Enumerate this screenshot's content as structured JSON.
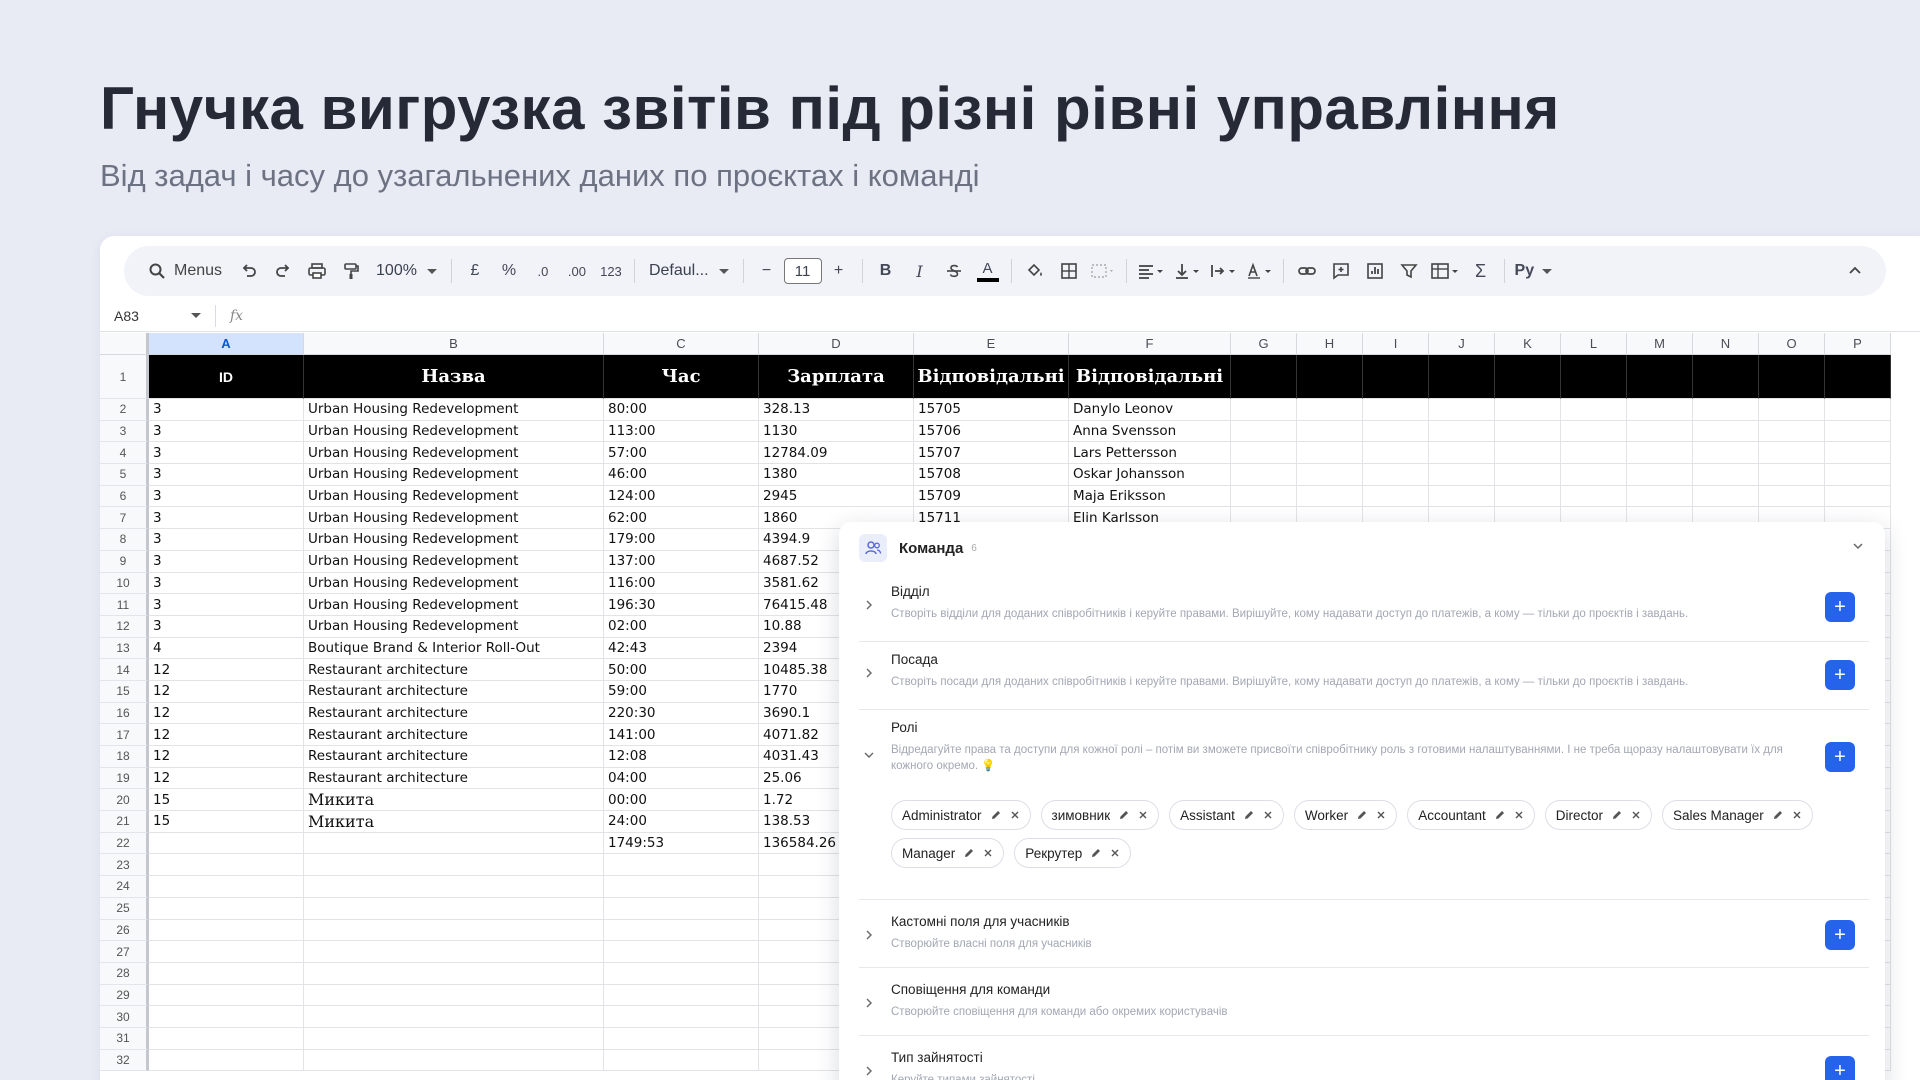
{
  "slide": {
    "title": "Гнучка вигрузка звітів під різні рівні управління",
    "subtitle": "Від задач і часу до узагальнених даних по проєктах і команді"
  },
  "toolbar": {
    "menus_label": "Menus",
    "zoom": "100%",
    "currency": "£",
    "percent": "%",
    "dec_less": ".0",
    "dec_more": ".00",
    "number_format": "123",
    "font": "Defaul...",
    "font_size": "11",
    "bold": "B",
    "italic": "I",
    "text_color_label": "A",
    "sigma": "Σ",
    "ru_label": "Pу"
  },
  "formula_bar": {
    "cell_ref": "A83",
    "fx": "fx"
  },
  "sheet": {
    "columns": [
      "A",
      "B",
      "C",
      "D",
      "E",
      "F",
      "G",
      "H",
      "I",
      "J",
      "K",
      "L",
      "M",
      "N",
      "O",
      "P"
    ],
    "selected_column": "A",
    "header": [
      "ID",
      "Назва",
      "Час",
      "Зарплата",
      "Відповідальні",
      "Відповідальні"
    ],
    "rows": [
      {
        "n": "2",
        "cells": [
          "3",
          "Urban Housing Redevelopment",
          "80:00",
          "328.13",
          "15705",
          "Danylo Leonov"
        ]
      },
      {
        "n": "3",
        "cells": [
          "3",
          "Urban Housing Redevelopment",
          "113:00",
          "1130",
          "15706",
          "Anna Svensson"
        ]
      },
      {
        "n": "4",
        "cells": [
          "3",
          "Urban Housing Redevelopment",
          "57:00",
          "12784.09",
          "15707",
          "Lars Pettersson"
        ]
      },
      {
        "n": "5",
        "cells": [
          "3",
          "Urban Housing Redevelopment",
          "46:00",
          "1380",
          "15708",
          "Oskar Johansson"
        ]
      },
      {
        "n": "6",
        "cells": [
          "3",
          "Urban Housing Redevelopment",
          "124:00",
          "2945",
          "15709",
          "Maja Eriksson"
        ]
      },
      {
        "n": "7",
        "cells": [
          "3",
          "Urban Housing Redevelopment",
          "62:00",
          "1860",
          "15711",
          "Elin Karlsson"
        ]
      },
      {
        "n": "8",
        "cells": [
          "3",
          "Urban Housing Redevelopment",
          "179:00",
          "4394.9",
          "",
          ""
        ]
      },
      {
        "n": "9",
        "cells": [
          "3",
          "Urban Housing Redevelopment",
          "137:00",
          "4687.52",
          "",
          ""
        ]
      },
      {
        "n": "10",
        "cells": [
          "3",
          "Urban Housing Redevelopment",
          "116:00",
          "3581.62",
          "",
          ""
        ]
      },
      {
        "n": "11",
        "cells": [
          "3",
          "Urban Housing Redevelopment",
          "196:30",
          "76415.48",
          "",
          ""
        ]
      },
      {
        "n": "12",
        "cells": [
          "3",
          "Urban Housing Redevelopment",
          "02:00",
          "10.88",
          "",
          ""
        ]
      },
      {
        "n": "13",
        "cells": [
          "4",
          "Boutique Brand & Interior Roll-Out",
          "42:43",
          "2394",
          "",
          ""
        ]
      },
      {
        "n": "14",
        "cells": [
          "12",
          "Restaurant architecture",
          "50:00",
          "10485.38",
          "",
          ""
        ]
      },
      {
        "n": "15",
        "cells": [
          "12",
          "Restaurant architecture",
          "59:00",
          "1770",
          "",
          ""
        ]
      },
      {
        "n": "16",
        "cells": [
          "12",
          "Restaurant architecture",
          "220:30",
          "3690.1",
          "",
          ""
        ]
      },
      {
        "n": "17",
        "cells": [
          "12",
          "Restaurant architecture",
          "141:00",
          "4071.82",
          "",
          ""
        ]
      },
      {
        "n": "18",
        "cells": [
          "12",
          "Restaurant architecture",
          "12:08",
          "4031.43",
          "",
          ""
        ]
      },
      {
        "n": "19",
        "cells": [
          "12",
          "Restaurant architecture",
          "04:00",
          "25.06",
          "",
          ""
        ]
      },
      {
        "n": "20",
        "cells": [
          "15",
          "Микита",
          "00:00",
          "1.72",
          "",
          ""
        ]
      },
      {
        "n": "21",
        "cells": [
          "15",
          "Микита",
          "24:00",
          "138.53",
          "",
          ""
        ]
      },
      {
        "n": "22",
        "cells": [
          "",
          "",
          "1749:53",
          "136584.26",
          "",
          ""
        ]
      },
      {
        "n": "23",
        "cells": [
          "",
          "",
          "",
          "",
          "",
          ""
        ]
      },
      {
        "n": "24",
        "cells": [
          "",
          "",
          "",
          "",
          "",
          ""
        ]
      },
      {
        "n": "25",
        "cells": [
          "",
          "",
          "",
          "",
          "",
          ""
        ]
      },
      {
        "n": "26",
        "cells": [
          "",
          "",
          "",
          "",
          "",
          ""
        ]
      },
      {
        "n": "27",
        "cells": [
          "",
          "",
          "",
          "",
          "",
          ""
        ]
      },
      {
        "n": "28",
        "cells": [
          "",
          "",
          "",
          "",
          "",
          ""
        ]
      },
      {
        "n": "29",
        "cells": [
          "",
          "",
          "",
          "",
          "",
          ""
        ]
      },
      {
        "n": "30",
        "cells": [
          "",
          "",
          "",
          "",
          "",
          ""
        ]
      },
      {
        "n": "31",
        "cells": [
          "",
          "",
          "",
          "",
          "",
          ""
        ]
      },
      {
        "n": "32",
        "cells": [
          "",
          "",
          "",
          "",
          "",
          ""
        ]
      }
    ]
  },
  "team_panel": {
    "title": "Команда",
    "count": "6",
    "sections": {
      "department": {
        "title": "Відділ",
        "desc": "Створіть відділи для доданих співробітників і керуйте правами. Вирішуйте, кому надавати доступ до платежів, а кому — тільки до проєктів і завдань."
      },
      "position": {
        "title": "Посада",
        "desc": "Створіть посади для доданих співробітників і керуйте правами. Вирішуйте, кому надавати доступ до платежів, а кому — тільки до проєктів і завдань."
      },
      "roles": {
        "title": "Ролі",
        "desc": "Відредагуйте права та доступи для кожної ролі – потім ви зможете присвоїти співробітнику роль з готовими налаштуваннями. І не треба щоразу налаштовувати їх для кожного окремо. 💡",
        "chips": [
          "Administrator",
          "зимовник",
          "Assistant",
          "Worker",
          "Accountant",
          "Director",
          "Sales Manager",
          "Manager",
          "Рекрутер"
        ]
      },
      "custom_fields": {
        "title": "Кастомні поля для учасників",
        "desc": "Створюйте власні поля для учасників"
      },
      "notifications": {
        "title": "Сповіщення для команди",
        "desc": "Створюйте сповіщення для команди або окремих користувачів"
      },
      "employment_type": {
        "title": "Тип зайнятості",
        "desc": "Керуйте типами зайнятості"
      }
    },
    "add_label": "+"
  },
  "colors": {
    "background": "#e8ebf4",
    "accent": "#2563eb",
    "header_fill": "#000000",
    "selected_col": "#d3e3fd"
  }
}
